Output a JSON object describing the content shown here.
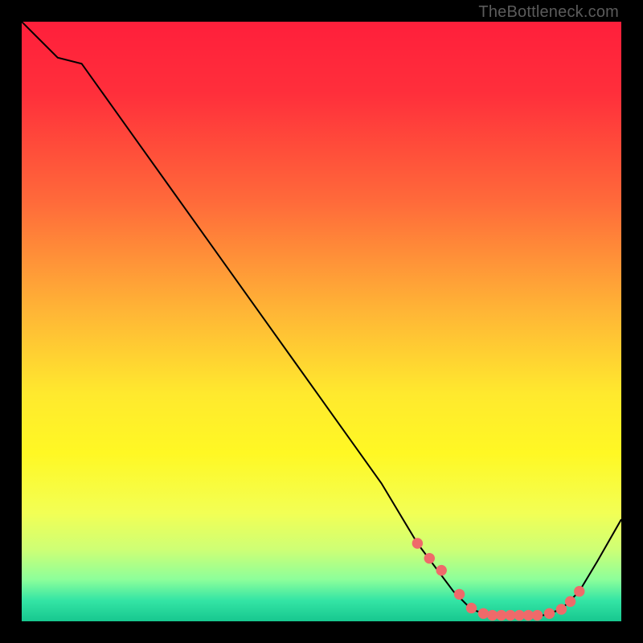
{
  "watermark": "TheBottleneck.com",
  "chart_data": {
    "type": "line",
    "title": "",
    "xlabel": "",
    "ylabel": "",
    "xlim": [
      0,
      100
    ],
    "ylim": [
      0,
      100
    ],
    "grid": false,
    "legend": false,
    "series": [
      {
        "name": "bottleneck-curve",
        "color": "#000000",
        "x": [
          0,
          3,
          6,
          10,
          15,
          20,
          25,
          30,
          35,
          40,
          45,
          50,
          55,
          60,
          63,
          66,
          69,
          72,
          75,
          78,
          81,
          84,
          87,
          90,
          93,
          96,
          100
        ],
        "y": [
          100,
          97,
          94,
          93,
          86,
          79,
          72,
          65,
          58,
          51,
          44,
          37,
          30,
          23,
          18,
          13,
          9,
          5,
          2,
          1,
          1,
          1,
          1,
          2,
          5,
          10,
          17
        ]
      }
    ],
    "markers": {
      "name": "highlighted-points",
      "color": "#ef6a6a",
      "x": [
        66,
        68,
        70,
        73,
        75,
        77,
        78.5,
        80,
        81.5,
        83,
        84.5,
        86,
        88,
        90,
        91.5,
        93
      ],
      "y": [
        13,
        10.5,
        8.5,
        4.5,
        2.2,
        1.3,
        1,
        1,
        1,
        1,
        1,
        1,
        1.3,
        2,
        3.3,
        5
      ]
    },
    "background_gradient": {
      "stops": [
        {
          "offset": 0.0,
          "color": "#ff1f3b"
        },
        {
          "offset": 0.12,
          "color": "#ff2f3b"
        },
        {
          "offset": 0.3,
          "color": "#ff6a3a"
        },
        {
          "offset": 0.48,
          "color": "#ffb436"
        },
        {
          "offset": 0.62,
          "color": "#ffe92e"
        },
        {
          "offset": 0.72,
          "color": "#fff824"
        },
        {
          "offset": 0.82,
          "color": "#f2ff55"
        },
        {
          "offset": 0.88,
          "color": "#ceff75"
        },
        {
          "offset": 0.93,
          "color": "#8dff9a"
        },
        {
          "offset": 0.965,
          "color": "#34e5a5"
        },
        {
          "offset": 1.0,
          "color": "#17c78f"
        }
      ]
    }
  }
}
